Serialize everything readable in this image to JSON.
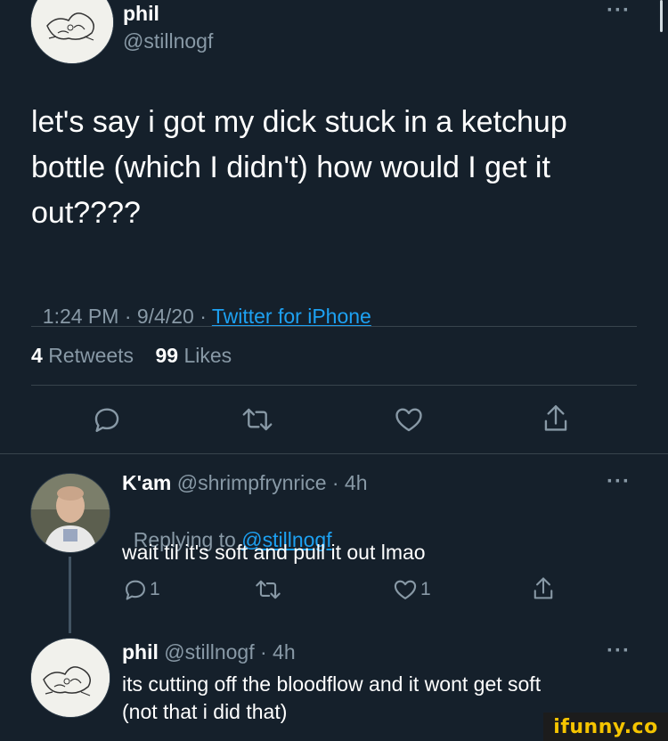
{
  "tweet": {
    "name": "phil",
    "handle": "@stillnogf",
    "text_line1": "let's say i got my dick stuck in a ketchup",
    "text_line2": "bottle (which I didn't) how would I get it",
    "text_line3": "out????",
    "time": "1:24 PM · 9/4/20 · ",
    "source": "Twitter for iPhone",
    "retweets_count": "4",
    "retweets_label": "Retweets",
    "likes_count": "99",
    "likes_label": "Likes",
    "more": "···"
  },
  "replies": [
    {
      "name": "K'am",
      "meta": "@shrimpfrynrice · 4h",
      "replying_label": "Replying to ",
      "replying_to": "@stillnogf",
      "text": "wait til it's soft and pull it out lmao",
      "reply_count": "1",
      "like_count": "1",
      "more": "···"
    },
    {
      "name": "phil",
      "meta": "@stillnogf · 4h",
      "text_line1": "its cutting off the bloodflow and it wont get soft",
      "text_line2": "(not that i did that)",
      "more": "···"
    }
  ],
  "watermark": "ifunny.co",
  "colors": {
    "background": "#15202b",
    "muted": "#8899a6",
    "link": "#1da1f2",
    "divider": "#38444d"
  }
}
